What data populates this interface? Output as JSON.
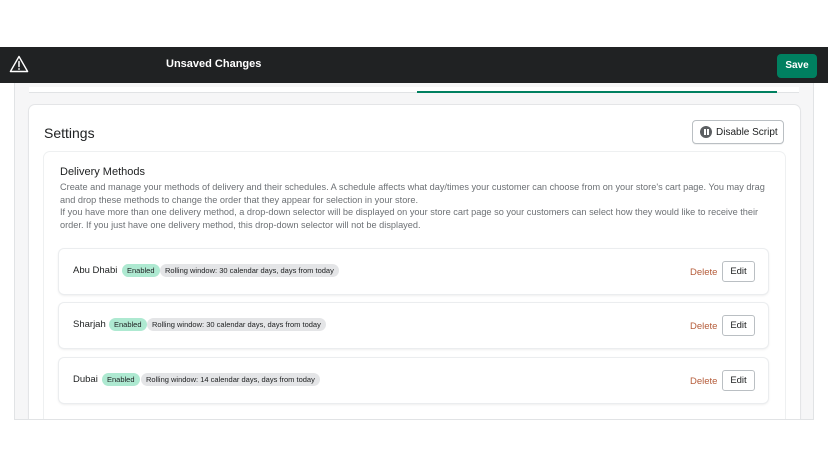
{
  "topbar": {
    "title": "Unsaved Changes",
    "save_label": "Save",
    "warning_icon": "warning-triangle-icon",
    "background": "#202223"
  },
  "settings": {
    "title": "Settings",
    "disable_script_label": "Disable Script",
    "disable_icon": "pause-icon"
  },
  "delivery_methods": {
    "title": "Delivery Methods",
    "description_1": "Create and manage your methods of delivery and their schedules. A schedule affects what day/times your customer can choose from on your store's cart page. You may drag and drop these methods to change the order that they appear for selection in your store.",
    "description_2": "If you have more than one delivery method, a drop-down selector will be displayed on your store cart page so your customers can select how they would like to receive their order. If you just have one delivery method, this drop-down selector will not be displayed.",
    "items": [
      {
        "name": "Abu Dhabi",
        "status": "Enabled",
        "window": "Rolling window: 30 calendar days, days from today",
        "delete_label": "Delete",
        "edit_label": "Edit"
      },
      {
        "name": "Sharjah",
        "status": "Enabled",
        "window": "Rolling window: 30 calendar days, days from today",
        "delete_label": "Delete",
        "edit_label": "Edit"
      },
      {
        "name": "Dubai",
        "status": "Enabled",
        "window": "Rolling window: 14 calendar days, days from today",
        "delete_label": "Delete",
        "edit_label": "Edit"
      }
    ]
  },
  "colors": {
    "primary": "#008060",
    "enabled_badge": "#aee9d1",
    "delete_link": "#b55c3a"
  }
}
